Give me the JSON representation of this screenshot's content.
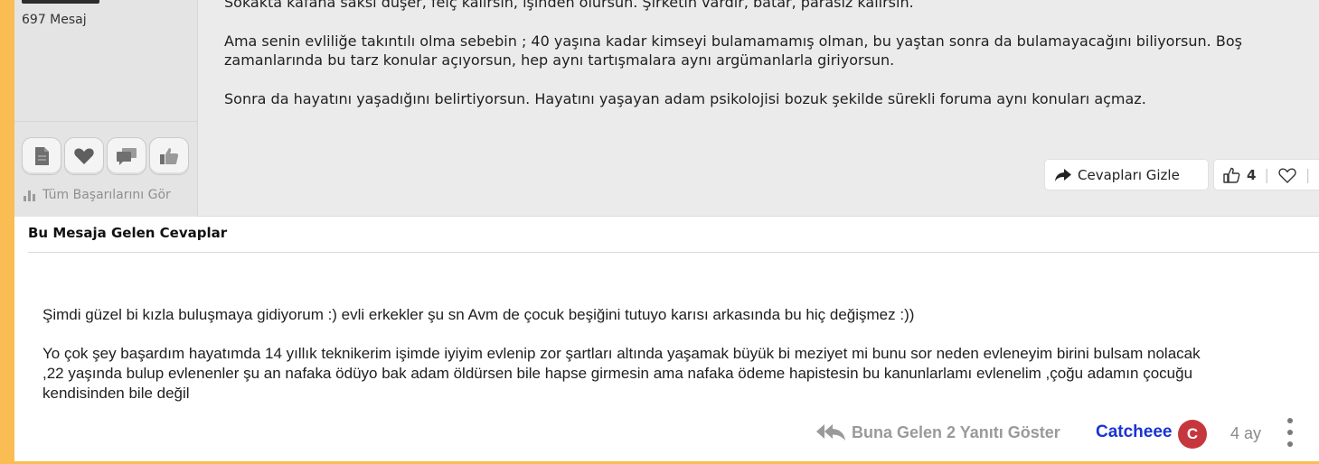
{
  "user": {
    "message_count": "697 Mesaj",
    "all_achievements_label": "Tüm Başarılarını Gör",
    "badges": [
      "document-icon",
      "heart-icon",
      "chat-icon",
      "thumbs-up-icon"
    ]
  },
  "post": {
    "paragraphs": [
      "Sokakta kafana saksı düşer, felç kalırsın, işinden olursun. Şirketin vardır, batar, parasız kalırsın.",
      "Ama senin evliliğe takıntılı olma sebebin ; 40 yaşına kadar kimseyi bulamamamış olman, bu yaştan sonra da bulamayacağını biliyorsun. Boş",
      "zamanlarında bu tarz konular açıyorsun, hep aynı tartışmalara aynı argümanlarla giriyorsun.",
      "Sonra da hayatını yaşadığını belirtiyorsun. Hayatını yaşayan adam psikolojisi bozuk şekilde sürekli foruma aynı konuları açmaz."
    ],
    "hide_replies_label": "Cevapları Gizle",
    "like_count": "4",
    "separator": "|"
  },
  "replies": {
    "title": "Bu Mesaja Gelen Cevaplar",
    "reply": {
      "lines": [
        "Şimdi güzel bi kızla buluşmaya gidiyorum :) evli erkekler şu sn Avm de çocuk beşiğini tutuyo karısı arkasında bu hiç değişmez :))",
        "Yo çok şey başardım hayatımda 14 yıllık teknikerim işimde iyiyim evlenip zor şartları altında yaşamak büyük bi meziyet mi bunu sor neden evleneyim birini bulsam nolacak",
        ",22 yaşında bulup evlenenler şu an nafaka ödüyo bak adam öldürsen bile hapse girmesin ama nafaka ödeme hapistesin bu kanunlarlamı evlenelim ,çoğu adamın çocuğu",
        "kendisinden bile değil"
      ],
      "show_replies_label": "Buna Gelen 2 Yanıtı Göster",
      "author": "Catcheee",
      "author_initial": "C",
      "time_ago": "4 ay"
    }
  },
  "colors": {
    "accent_stripe": "#f9bd54",
    "author_link": "#1a33d4",
    "avatar_bg": "#c6373d"
  }
}
